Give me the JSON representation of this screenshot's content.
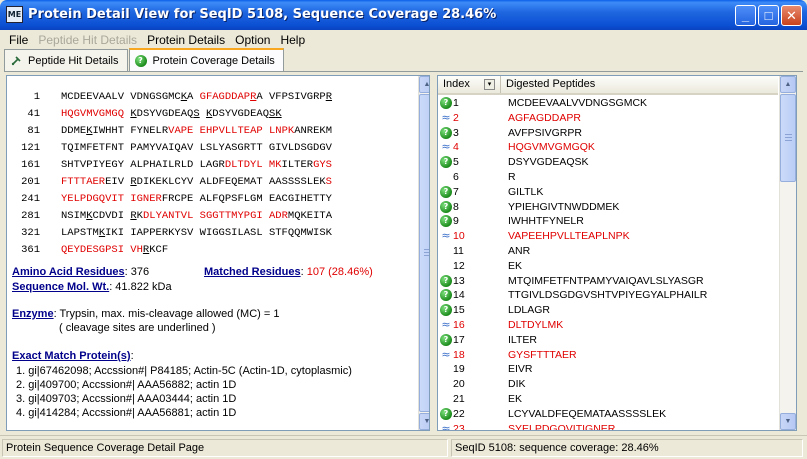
{
  "window": {
    "icon_text": "ME",
    "title": "Protein Detail View for SeqID 5108, Sequence Coverage 28.46%",
    "min_glyph": "_",
    "max_glyph": "□",
    "close_glyph": "✕"
  },
  "menu": [
    "File",
    "Peptide Hit Details",
    "Protein Details",
    "Option",
    "Help"
  ],
  "tabs": [
    {
      "label": "Peptide Hit Details",
      "icon": "pin-icon"
    },
    {
      "label": "Protein Coverage Details",
      "icon": "question-icon"
    }
  ],
  "sequence_rows": [
    {
      "num": "1",
      "segments": [
        {
          "t": "MCDEEVAALV VDNGSGMC"
        },
        {
          "t": "K",
          "u": true
        },
        {
          "t": "A "
        },
        {
          "t": "GFAGDDAP",
          "r": true
        },
        {
          "t": "R",
          "r": true,
          "u": true
        },
        {
          "t": "A VFPSIVGRP"
        },
        {
          "t": "R",
          "u": true
        }
      ]
    },
    {
      "num": "41",
      "segments": [
        {
          "t": "HQGVMVGMGQ",
          "r": true
        },
        {
          "t": " "
        },
        {
          "t": "K",
          "u": true
        },
        {
          "t": "DSYVGDEAQ"
        },
        {
          "t": "S",
          "u": true
        },
        {
          "t": " "
        },
        {
          "t": "K",
          "u": true
        },
        {
          "t": "DSYVGDEAQ"
        },
        {
          "t": "S",
          "u": true
        },
        {
          "t": "K",
          "u": true
        }
      ]
    },
    {
      "num": "81",
      "segments": [
        {
          "t": "DDME"
        },
        {
          "t": "K",
          "u": true
        },
        {
          "t": "IWHHT FYNELR"
        },
        {
          "t": "VAPE EHPVLLTEAP LNPK",
          "r": true
        },
        {
          "t": "ANREKM"
        }
      ]
    },
    {
      "num": "121",
      "segments": [
        {
          "t": "TQIMFETFNT PAMYVAIQAV LSLYASGRTT GIVLDSGDGV"
        }
      ]
    },
    {
      "num": "161",
      "segments": [
        {
          "t": "SHTVPIYEGY ALPHAILRLD LAGR"
        },
        {
          "t": "DLTDYL MK",
          "r": true
        },
        {
          "t": "ILTER"
        },
        {
          "t": "GYS",
          "r": true
        }
      ]
    },
    {
      "num": "201",
      "segments": [
        {
          "t": "FTTTAER",
          "r": true
        },
        {
          "t": "EIV "
        },
        {
          "t": "R",
          "u": true
        },
        {
          "t": "DIKEKLCYV ALDFEQEMAT AASSSSLEK"
        },
        {
          "t": "S",
          "r": true
        }
      ]
    },
    {
      "num": "241",
      "segments": [
        {
          "t": "YELPDGQVIT IGNER",
          "r": true
        },
        {
          "t": "FRCPE ALFQPSFLGM EACGIHETTY"
        }
      ]
    },
    {
      "num": "281",
      "segments": [
        {
          "t": "NSIM"
        },
        {
          "t": "K",
          "u": true
        },
        {
          "t": "CDVDI "
        },
        {
          "t": "R",
          "u": true
        },
        {
          "t": "K"
        },
        {
          "t": "DLYANTVL SGGTTMYPGI ADR",
          "r": true
        },
        {
          "t": "MQKEITA"
        }
      ]
    },
    {
      "num": "321",
      "segments": [
        {
          "t": "LAPSTM"
        },
        {
          "t": "K",
          "u": true
        },
        {
          "t": "IKI IAPPERKYSV WIGGSILASL STFQQMWISK"
        }
      ]
    },
    {
      "num": "361",
      "segments": [
        {
          "t": "QEYDESGPSI VH",
          "r": true
        },
        {
          "t": "R",
          "u": true
        },
        {
          "t": "KCF"
        }
      ]
    }
  ],
  "summary": {
    "aa_label": "Amino Acid Residues",
    "aa_value": ": 376",
    "matched_label": "Matched Residues",
    "matched_sep": ": ",
    "matched_value": "107 (28.46%)",
    "mw_label": "Sequence Mol. Wt.",
    "mw_value": ":  41.822 kDa",
    "enzyme_label": "Enzyme",
    "enzyme_value": ": Trypsin, max. mis-cleavage allowed (MC) = 1",
    "enzyme_note": "( cleavage sites are underlined )",
    "exact_label": "Exact Match Protein(s)",
    "exact_colon": ":",
    "proteins": [
      "1.  gi|67462098;  Accssion#| P84185;  Actin-5C (Actin-1D, cytoplasmic)",
      "2.  gi|409700;  Accssion#| AAA56882;  actin 1D",
      "3.  gi|409703;  Accssion#| AAA03444;  actin 1D",
      "4.  gi|414284;  Accssion#| AAA56881;  actin 1D"
    ]
  },
  "grid": {
    "col_index": "Index",
    "col_peptides": "Digested Peptides",
    "rows": [
      {
        "idx": "1",
        "pep": "MCDEEVAALVVDNGSGMCK",
        "icon": "check",
        "hit": false
      },
      {
        "idx": "2",
        "pep": "AGFAGDDAPR",
        "icon": "link",
        "hit": true
      },
      {
        "idx": "3",
        "pep": "AVFPSIVGRPR",
        "icon": "check",
        "hit": false
      },
      {
        "idx": "4",
        "pep": "HQGVMVGMGQK",
        "icon": "link",
        "hit": true
      },
      {
        "idx": "5",
        "pep": "DSYVGDEAQSK",
        "icon": "check",
        "hit": false
      },
      {
        "idx": "6",
        "pep": "R",
        "icon": "",
        "hit": false
      },
      {
        "idx": "7",
        "pep": "GILTLK",
        "icon": "check",
        "hit": false
      },
      {
        "idx": "8",
        "pep": "YPIEHGIVTNWDDMEK",
        "icon": "check",
        "hit": false
      },
      {
        "idx": "9",
        "pep": "IWHHTFYNELR",
        "icon": "check",
        "hit": false
      },
      {
        "idx": "10",
        "pep": "VAPEEHPVLLTEAPLNPK",
        "icon": "link",
        "hit": true
      },
      {
        "idx": "11",
        "pep": "ANR",
        "icon": "",
        "hit": false
      },
      {
        "idx": "12",
        "pep": "EK",
        "icon": "",
        "hit": false
      },
      {
        "idx": "13",
        "pep": "MTQIMFETFNTPAMYVAIQAVLSLYASGR",
        "icon": "check",
        "hit": false
      },
      {
        "idx": "14",
        "pep": "TTGIVLDSGDGVSHTVPIYEGYALPHAILR",
        "icon": "check",
        "hit": false
      },
      {
        "idx": "15",
        "pep": "LDLAGR",
        "icon": "check",
        "hit": false
      },
      {
        "idx": "16",
        "pep": "DLTDYLMK",
        "icon": "link",
        "hit": true
      },
      {
        "idx": "17",
        "pep": "ILTER",
        "icon": "check",
        "hit": false
      },
      {
        "idx": "18",
        "pep": "GYSFTTTAER",
        "icon": "link",
        "hit": true
      },
      {
        "idx": "19",
        "pep": "EIVR",
        "icon": "",
        "hit": false
      },
      {
        "idx": "20",
        "pep": "DIK",
        "icon": "",
        "hit": false
      },
      {
        "idx": "21",
        "pep": "EK",
        "icon": "",
        "hit": false
      },
      {
        "idx": "22",
        "pep": "LCYVALDFEQEMATAASSSSLEK",
        "icon": "check",
        "hit": false
      },
      {
        "idx": "23",
        "pep": "SYELPDGQVITIGNER",
        "icon": "link",
        "hit": true
      }
    ]
  },
  "status": {
    "left": "Protein Sequence Coverage Detail Page",
    "right": "SeqID 5108: sequence coverage: 28.46%"
  },
  "colors": {
    "hit": "#e00000",
    "link": "#00008b",
    "title_bar": "#0b4fd3"
  }
}
